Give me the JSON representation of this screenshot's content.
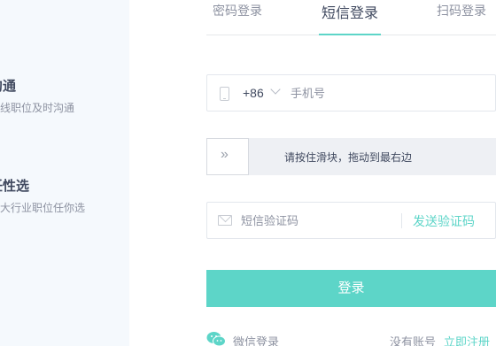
{
  "features": [
    {
      "title": "沟通",
      "desc": "在线职位及时沟通"
    },
    {
      "title": "任性选",
      "desc": "各大行业职位任你选"
    }
  ],
  "tabs": [
    {
      "label": "密码登录",
      "active": false
    },
    {
      "label": "短信登录",
      "active": true
    },
    {
      "label": "扫码登录",
      "active": false
    }
  ],
  "phone": {
    "icon": "phone-icon",
    "country_code": "+86",
    "placeholder": "手机号",
    "value": ""
  },
  "slider": {
    "handle_glyph": "»",
    "text": "请按住滑块，拖动到最右边"
  },
  "sms": {
    "icon": "mail-icon",
    "placeholder": "短信验证码",
    "value": "",
    "send_label": "发送验证码"
  },
  "login": {
    "label": "登录"
  },
  "footer": {
    "wechat_label": "微信登录",
    "no_account": "没有账号",
    "register_label": "立即注册"
  },
  "colors": {
    "accent": "#5dd5c8",
    "text_primary": "#414a60",
    "text_secondary": "#8d92a1",
    "left_panel_bg": "#f5f9fd"
  }
}
